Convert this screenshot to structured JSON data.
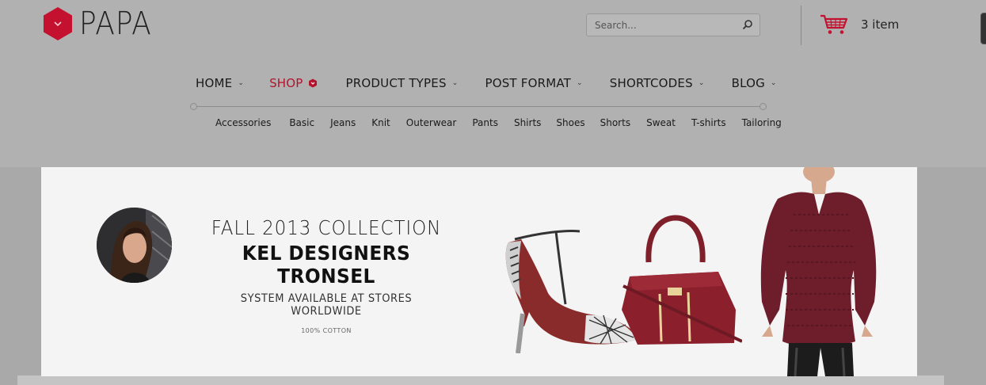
{
  "brand": {
    "name": "PAPA",
    "color": "#c4112f"
  },
  "search": {
    "placeholder": "Search..."
  },
  "cart": {
    "label": "3 item"
  },
  "nav": {
    "items": [
      {
        "label": "HOME"
      },
      {
        "label": "SHOP"
      },
      {
        "label": "PRODUCT TYPES"
      },
      {
        "label": "POST FORMAT"
      },
      {
        "label": "SHORTCODES"
      },
      {
        "label": "BLOG"
      }
    ],
    "active": "SHOP"
  },
  "subnav": {
    "items": [
      "Accessories",
      "Basic",
      "Jeans",
      "Knit",
      "Outerwear",
      "Pants",
      "Shirts",
      "Shoes",
      "Shorts",
      "Sweat",
      "T-shirts",
      "Tailoring"
    ]
  },
  "banner": {
    "line1": "FALL 2013 COLLECTION",
    "line2": "KEL DESIGNERS TRONSEL",
    "line3": "SYSTEM AVAILABLE AT STORES WORLDWIDE",
    "line4": "100% COTTON"
  }
}
